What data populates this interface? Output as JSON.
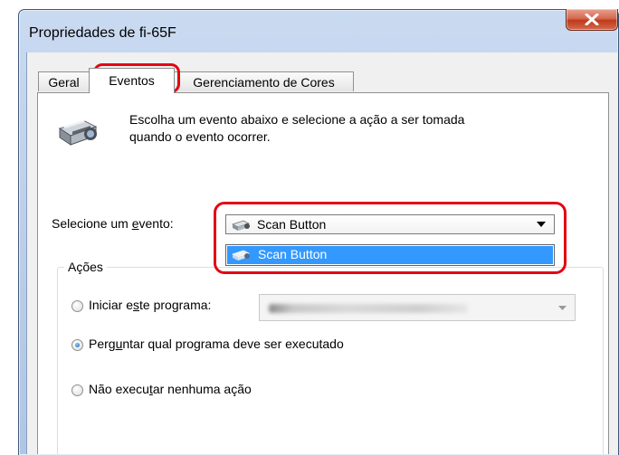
{
  "window": {
    "title": "Propriedades de fi-65F"
  },
  "tabs": [
    {
      "label": "Geral",
      "selected": false
    },
    {
      "label": "Eventos",
      "selected": true
    },
    {
      "label": "Gerenciamento de Cores",
      "selected": false
    }
  ],
  "events_tab": {
    "description_line1": "Escolha um evento abaixo e selecione a ação a ser tomada",
    "description_line2": "quando o evento ocorrer.",
    "event_label_pre": "Selecione um ",
    "event_label_key": "e",
    "event_label_post": "vento:",
    "event_value": "Scan Button",
    "dropdown_options": [
      "Scan Button"
    ],
    "actions": {
      "legend": "Ações",
      "start_program": {
        "pre": "Iniciar e",
        "key": "s",
        "post": "te programa:",
        "checked": false
      },
      "program_value_obscured": true,
      "ask_program": {
        "pre": "Perg",
        "key": "u",
        "post": "ntar qual programa deve ser executado",
        "checked": true
      },
      "no_action": {
        "pre": "Não execu",
        "key": "t",
        "post": "ar nenhuma ação",
        "checked": false
      }
    }
  },
  "colors": {
    "highlight": "#e30613",
    "selection": "#3399ff"
  },
  "icons": [
    "close-icon",
    "scanner-icon",
    "scan-button-icon",
    "dropdown-arrow-icon"
  ]
}
